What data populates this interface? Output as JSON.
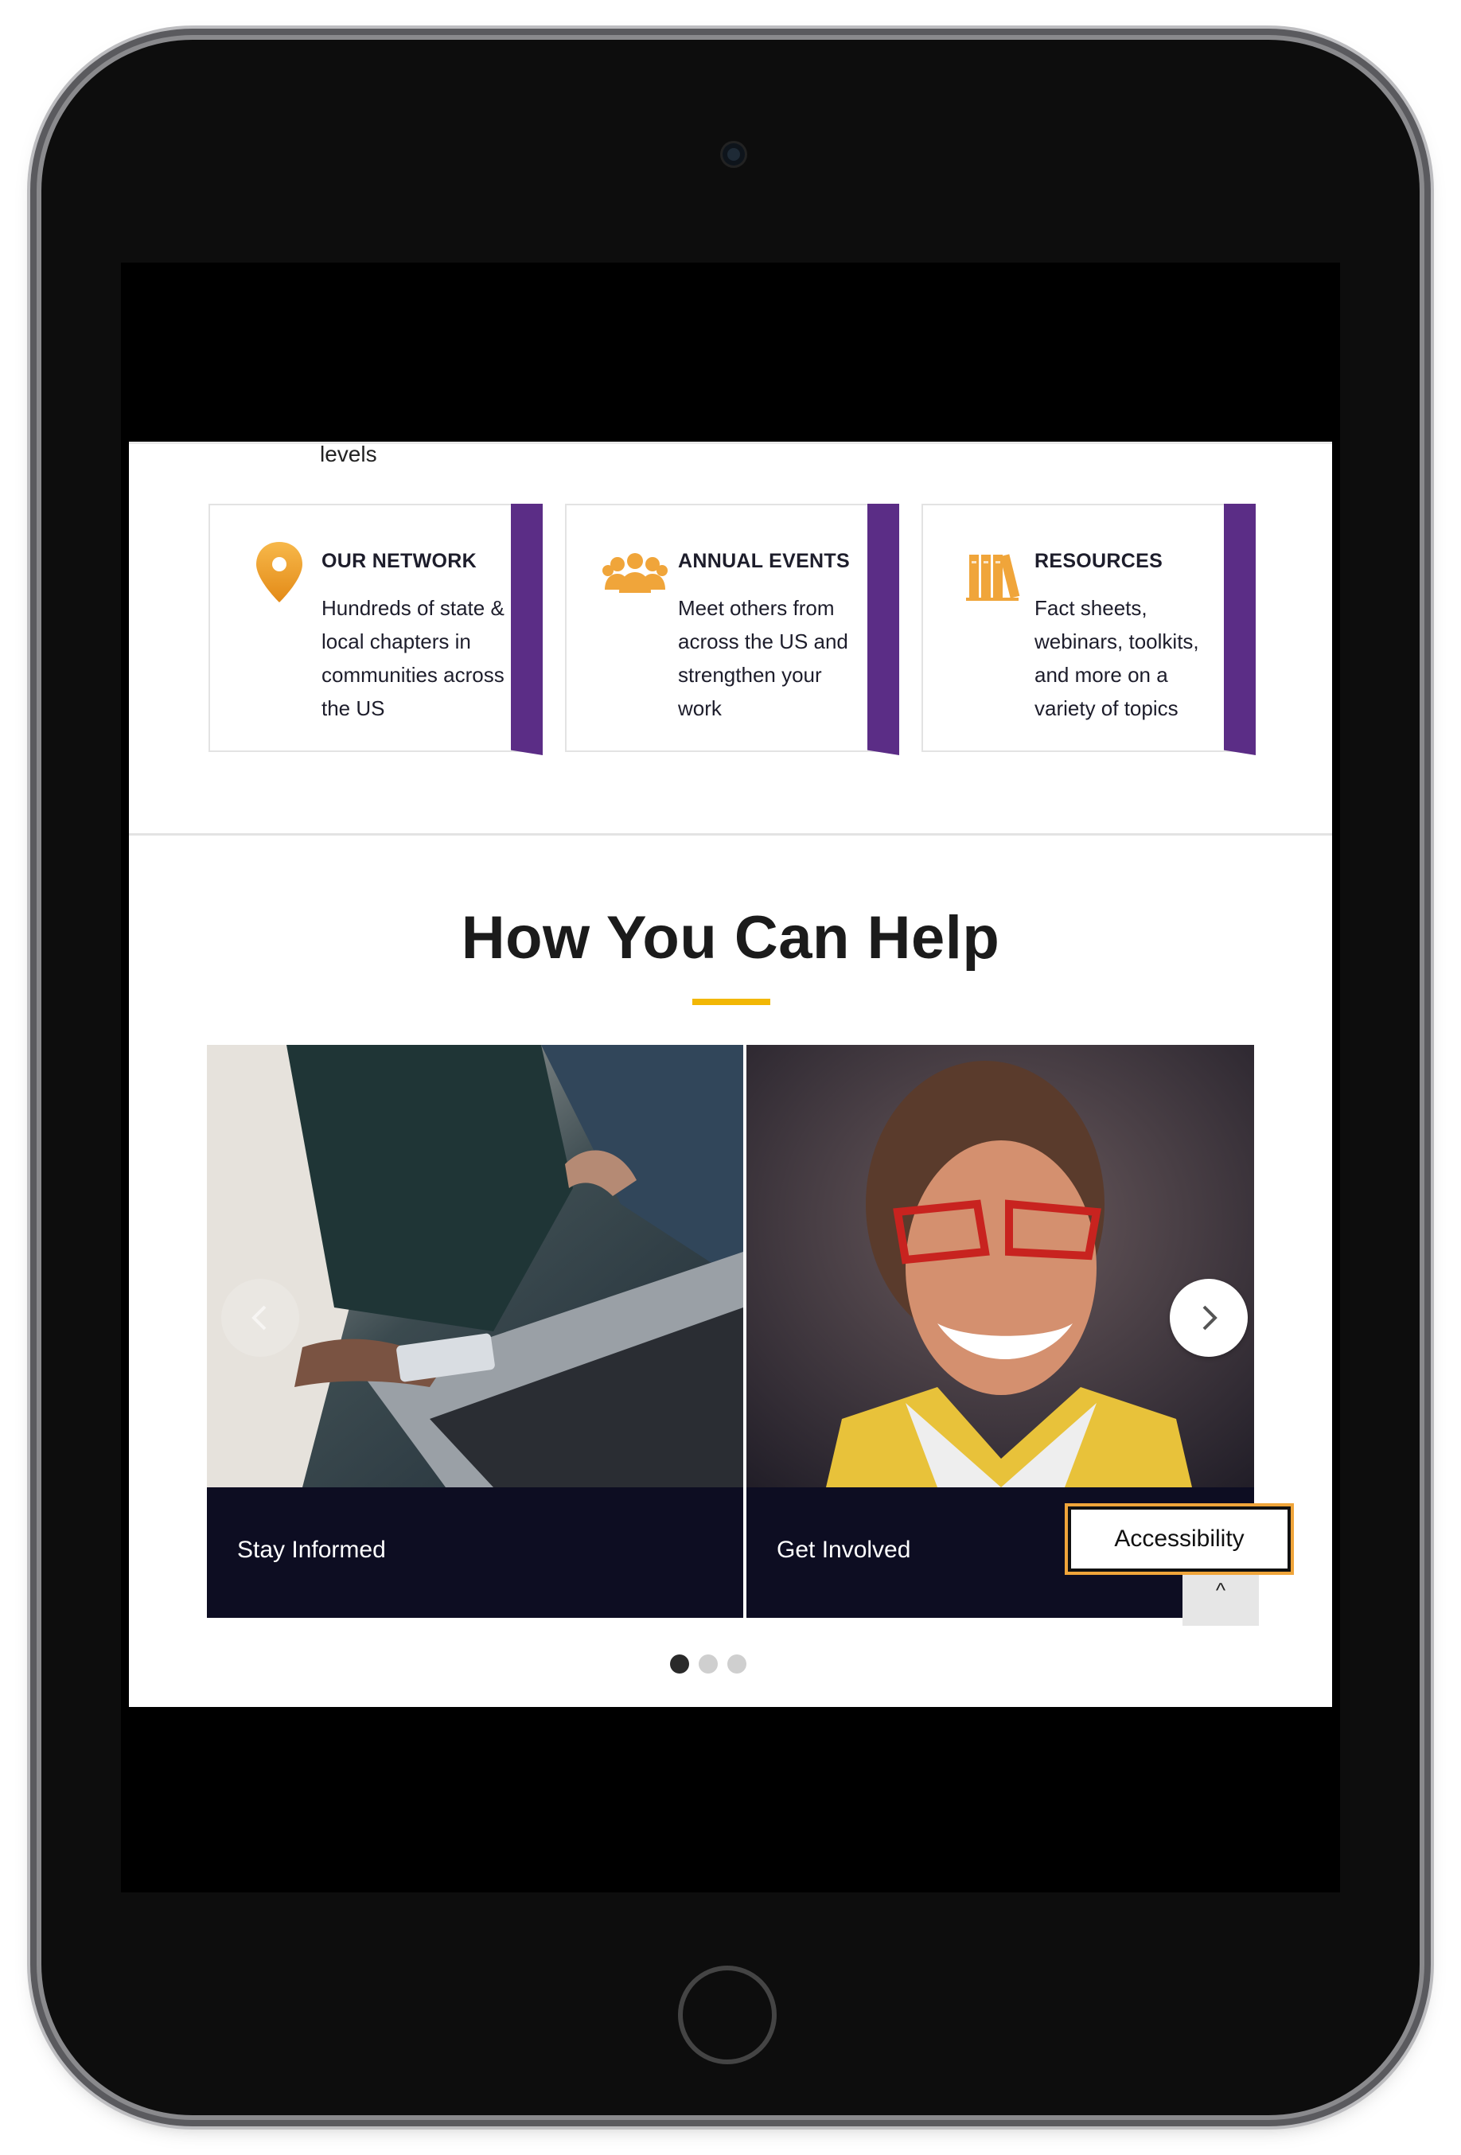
{
  "partial_text": "levels",
  "features": [
    {
      "title": "OUR NETWORK",
      "description": "Hundreds of state & local chapters in communities across the US",
      "icon": "map-pin-icon"
    },
    {
      "title": "ANNUAL EVENTS",
      "description": "Meet others from across the US and strengthen your work",
      "icon": "people-group-icon"
    },
    {
      "title": "RESOURCES",
      "description": "Fact sheets, webinars, toolkits, and more on a variety of topics",
      "icon": "books-icon"
    }
  ],
  "section": {
    "title": "How You Can Help"
  },
  "slides": [
    {
      "caption": "Stay Informed"
    },
    {
      "caption": "Get Involved"
    }
  ],
  "accessibility": {
    "label": "Accessibility"
  },
  "scroll_top": {
    "label": "^"
  },
  "carousel_dots": {
    "count": 3,
    "active": 0
  },
  "colors": {
    "accent_purple": "#5b2d86",
    "accent_gold": "#f2b705",
    "caption_bg": "#0d0d22",
    "icon_orange": "#f0a53a"
  }
}
